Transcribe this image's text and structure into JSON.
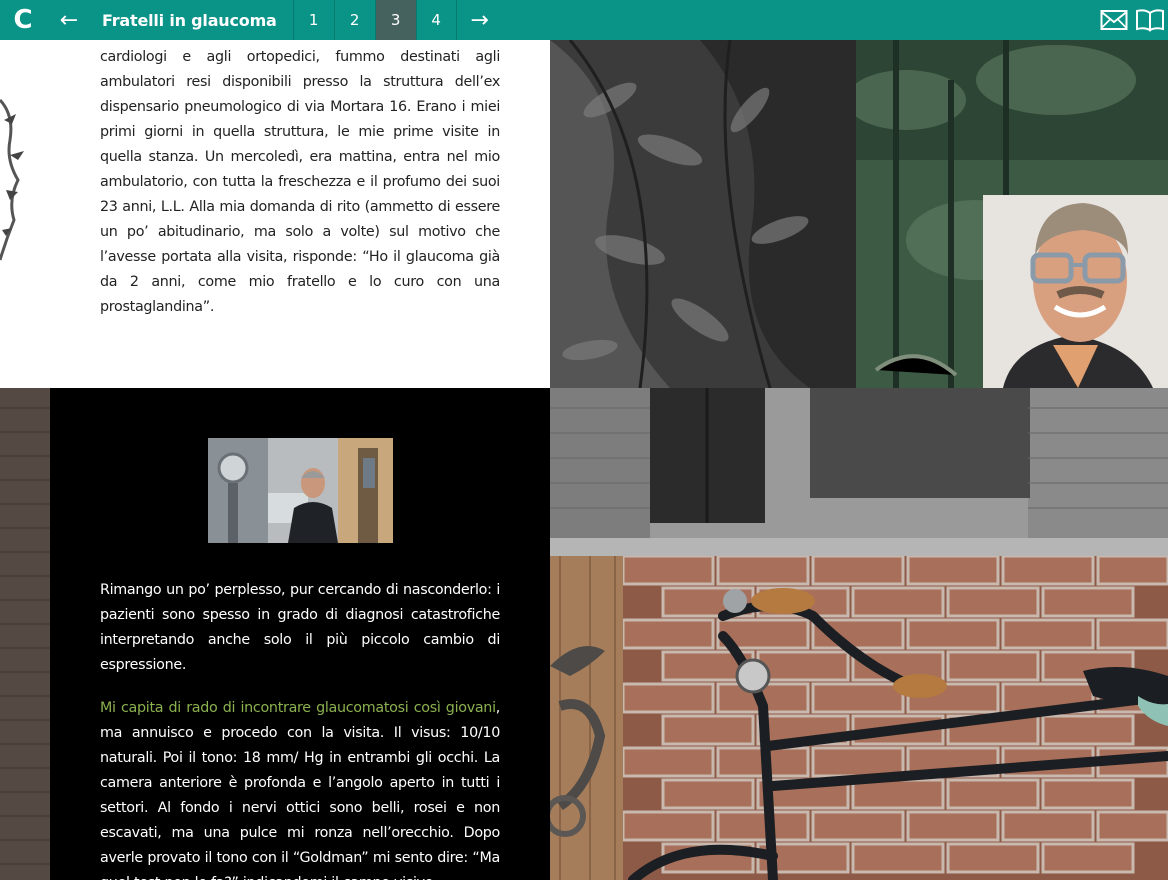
{
  "topbar": {
    "logo": "C",
    "prev_label": "←",
    "title": "Fratelli in glaucoma",
    "pages": [
      "1",
      "2",
      "3",
      "4"
    ],
    "active_page": "3",
    "next_label": "→"
  },
  "icons": {
    "mail": "mail-icon",
    "book": "book-icon"
  },
  "article": {
    "paragraph1": "cardiologi e agli ortopedici, fummo destinati agli ambulatori resi disponibili presso la struttura dell’ex dispensario pneumologico di via Mortara 16. Erano i miei primi giorni in quella struttura, le mie prime visite in quella stanza. Un mercoledì, era mattina, entra nel mio ambulatorio, con tutta la freschezza e il profumo dei suoi 23 anni, L.L. Alla mia domanda di rito (ammetto di essere un po’ abitudinario, ma solo a volte) sul motivo che l’avesse portata alla visita, risponde: “Ho il glaucoma già da 2 anni, come mio fratello e lo curo con una prostaglandina”.",
    "paragraph2": "Rimango un po’ perplesso, pur cercando di nasconderlo: i pazienti sono spesso in grado di diagnosi catastrofiche interpretando anche solo il più piccolo cambio di espressione.",
    "paragraph3_highlight": "Mi capita di rado di incontrare glaucomatosi così giovani",
    "paragraph3_rest": ", ma annuisco e procedo con la visita. Il visus: 10/10 naturali. Poi il tono: 18 mm/ Hg in entrambi gli occhi. La camera anteriore è profonda e l’angolo aperto in tutti i settori. Al fondo i nervi ottici sono belli, rosei e non escavati, ma una pulce mi ronza nell’orecchio. Dopo averle provato il tono con il “Goldman” mi sento dire: “Ma quel test non lo fa?” indicandomi il campo visivo."
  },
  "colors": {
    "topbar": "#0a9387",
    "active_page": "#45625f",
    "highlight_text": "#8bb14f"
  }
}
